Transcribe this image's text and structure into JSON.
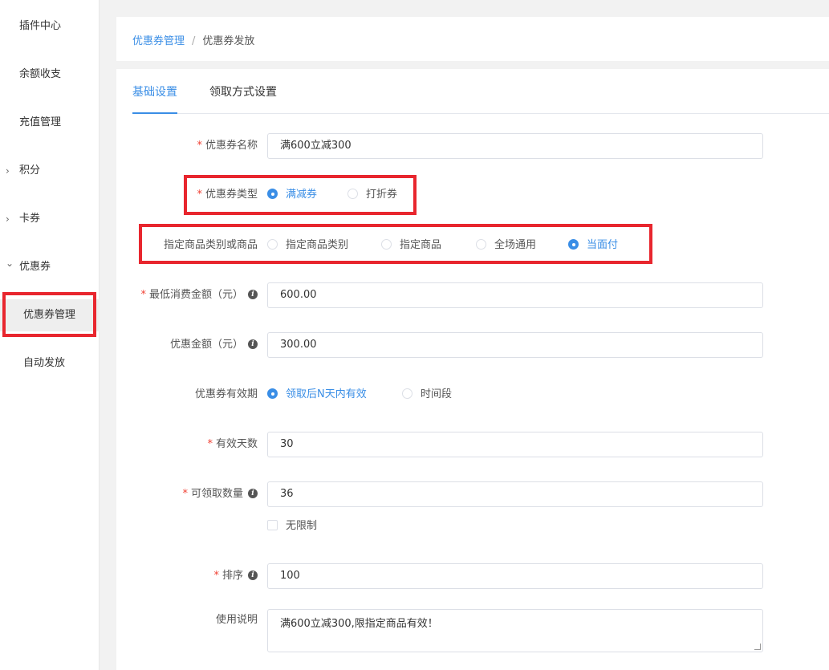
{
  "sidebar": {
    "items": [
      {
        "label": "插件中心"
      },
      {
        "label": "余额收支"
      },
      {
        "label": "充值管理"
      },
      {
        "label": "积分",
        "arrow": "›"
      },
      {
        "label": "卡券",
        "arrow": "›"
      },
      {
        "label": "优惠券",
        "arrow": "⌄"
      },
      {
        "label": "优惠券管理"
      },
      {
        "label": "自动发放"
      }
    ]
  },
  "breadcrumb": {
    "parent": "优惠券管理",
    "separator": "/",
    "current": "优惠券发放"
  },
  "tabs": [
    {
      "label": "基础设置"
    },
    {
      "label": "领取方式设置"
    }
  ],
  "form": {
    "required_mark": "*",
    "name": {
      "label": "优惠券名称",
      "value": "满600立减300"
    },
    "type": {
      "label": "优惠券类型",
      "options": [
        "满减券",
        "打折券"
      ],
      "selected": "满减券"
    },
    "scope": {
      "label": "指定商品类别或商品",
      "options": [
        "指定商品类别",
        "指定商品",
        "全场通用",
        "当面付"
      ],
      "selected": "当面付"
    },
    "min_amount": {
      "label": "最低消费金额（元）",
      "value": "600.00"
    },
    "discount": {
      "label": "优惠金额（元）",
      "value": "300.00"
    },
    "validity": {
      "label": "优惠券有效期",
      "options": [
        "领取后N天内有效",
        "时间段"
      ],
      "selected": "领取后N天内有效"
    },
    "days": {
      "label": "有效天数",
      "value": "30"
    },
    "quantity": {
      "label": "可领取数量",
      "value": "36",
      "unlimited_label": "无限制"
    },
    "sort": {
      "label": "排序",
      "value": "100"
    },
    "desc": {
      "label": "使用说明",
      "value": "满600立减300,限指定商品有效！"
    }
  },
  "info_icon_glyph": "i",
  "colors": {
    "accent": "#3a8ee6",
    "required": "#f04134",
    "highlight": "#e8262e"
  }
}
